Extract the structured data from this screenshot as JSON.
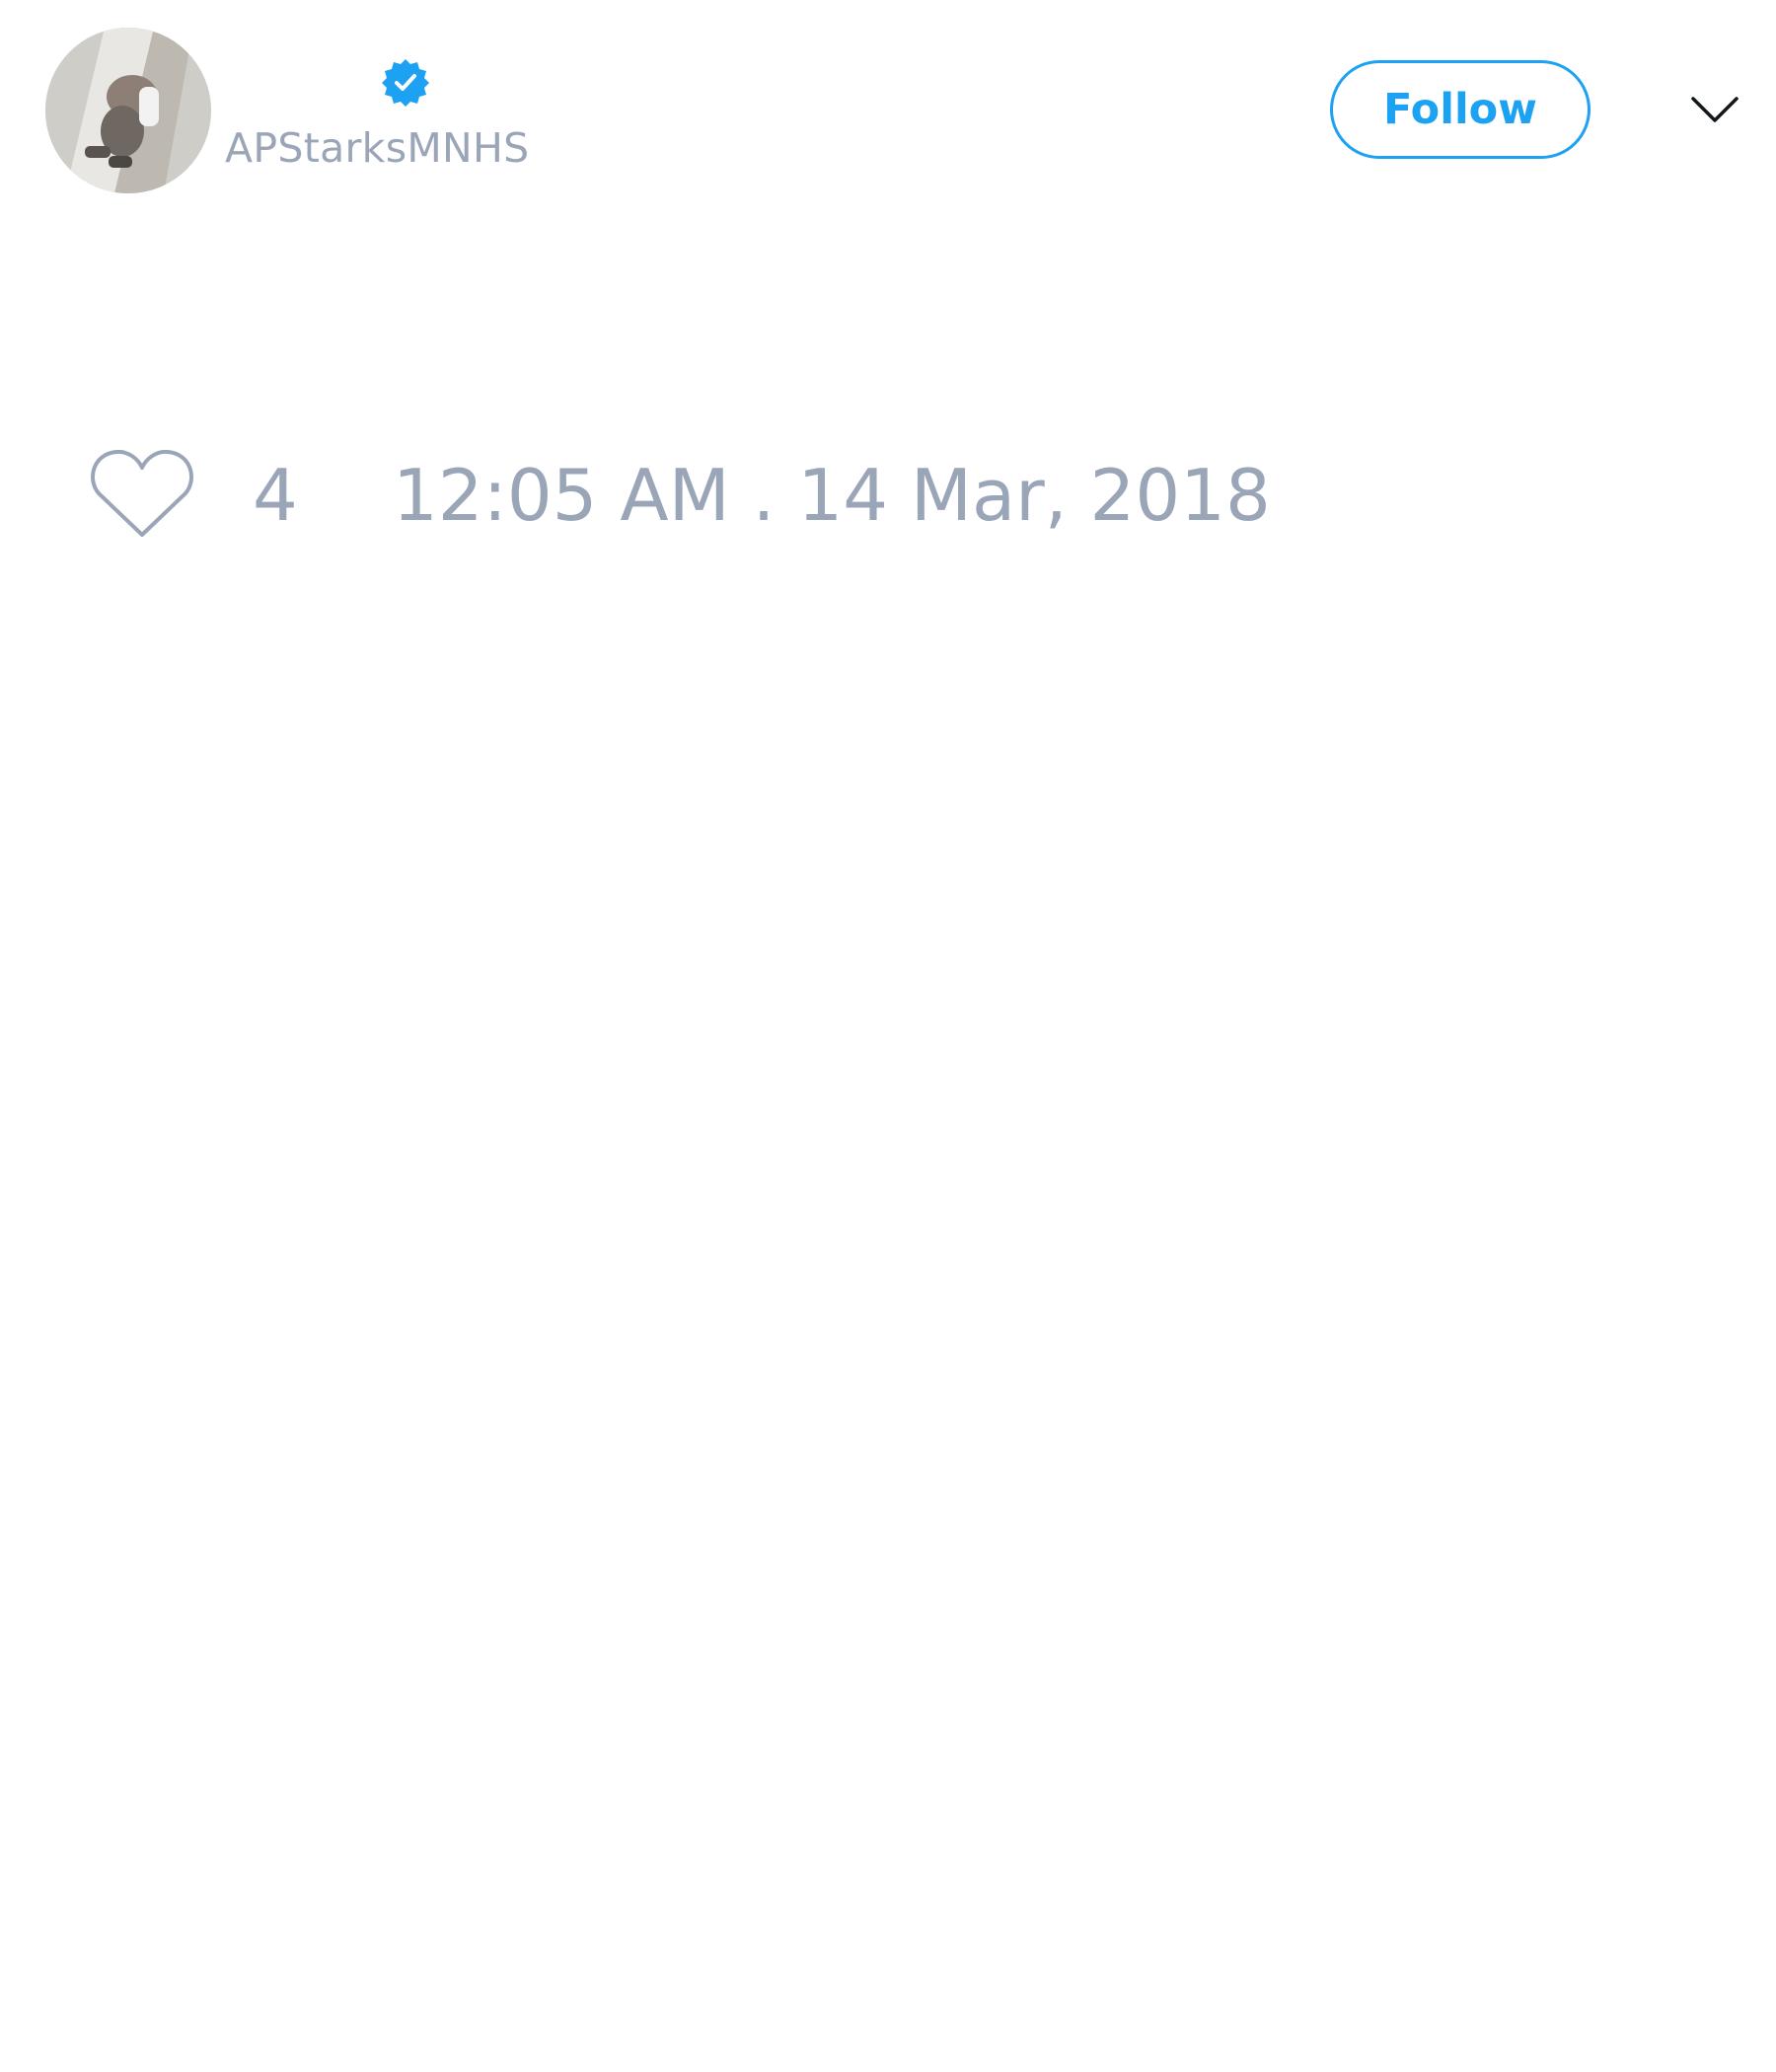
{
  "header": {
    "avatar_icon": "profile-photo",
    "verified_icon": "verified-badge-icon",
    "handle": "APStarksMNHS",
    "follow_label": "Follow",
    "menu_icon": "chevron-down-icon"
  },
  "footer": {
    "like_icon": "heart-icon",
    "like_count": "4",
    "timestamp": "12:05 AM . 14 Mar, 2018"
  },
  "colors": {
    "accent": "#1da1f2",
    "muted_text": "#9aa6b8",
    "background": "#ffffff"
  }
}
